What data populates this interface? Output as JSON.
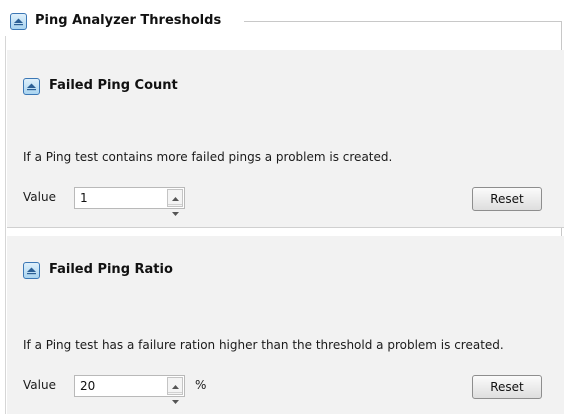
{
  "section": {
    "title": "Ping Analyzer Thresholds"
  },
  "failed_count": {
    "title": "Failed Ping Count",
    "description": "If a Ping test contains more failed pings a problem is created.",
    "value_label": "Value",
    "value": "1",
    "reset_label": "Reset"
  },
  "failed_ratio": {
    "title": "Failed Ping Ratio",
    "description": "If a Ping test has a failure ration higher than the threshold a problem is created.",
    "value_label": "Value",
    "value": "20",
    "unit": "%",
    "reset_label": "Reset"
  },
  "icons": {
    "collapse": "collapse-up-icon",
    "spin_up": "spin-up-icon",
    "spin_down": "spin-down-icon"
  },
  "colors": {
    "accent": "#3b77b5",
    "panel_bg": "#f2f2f2"
  }
}
